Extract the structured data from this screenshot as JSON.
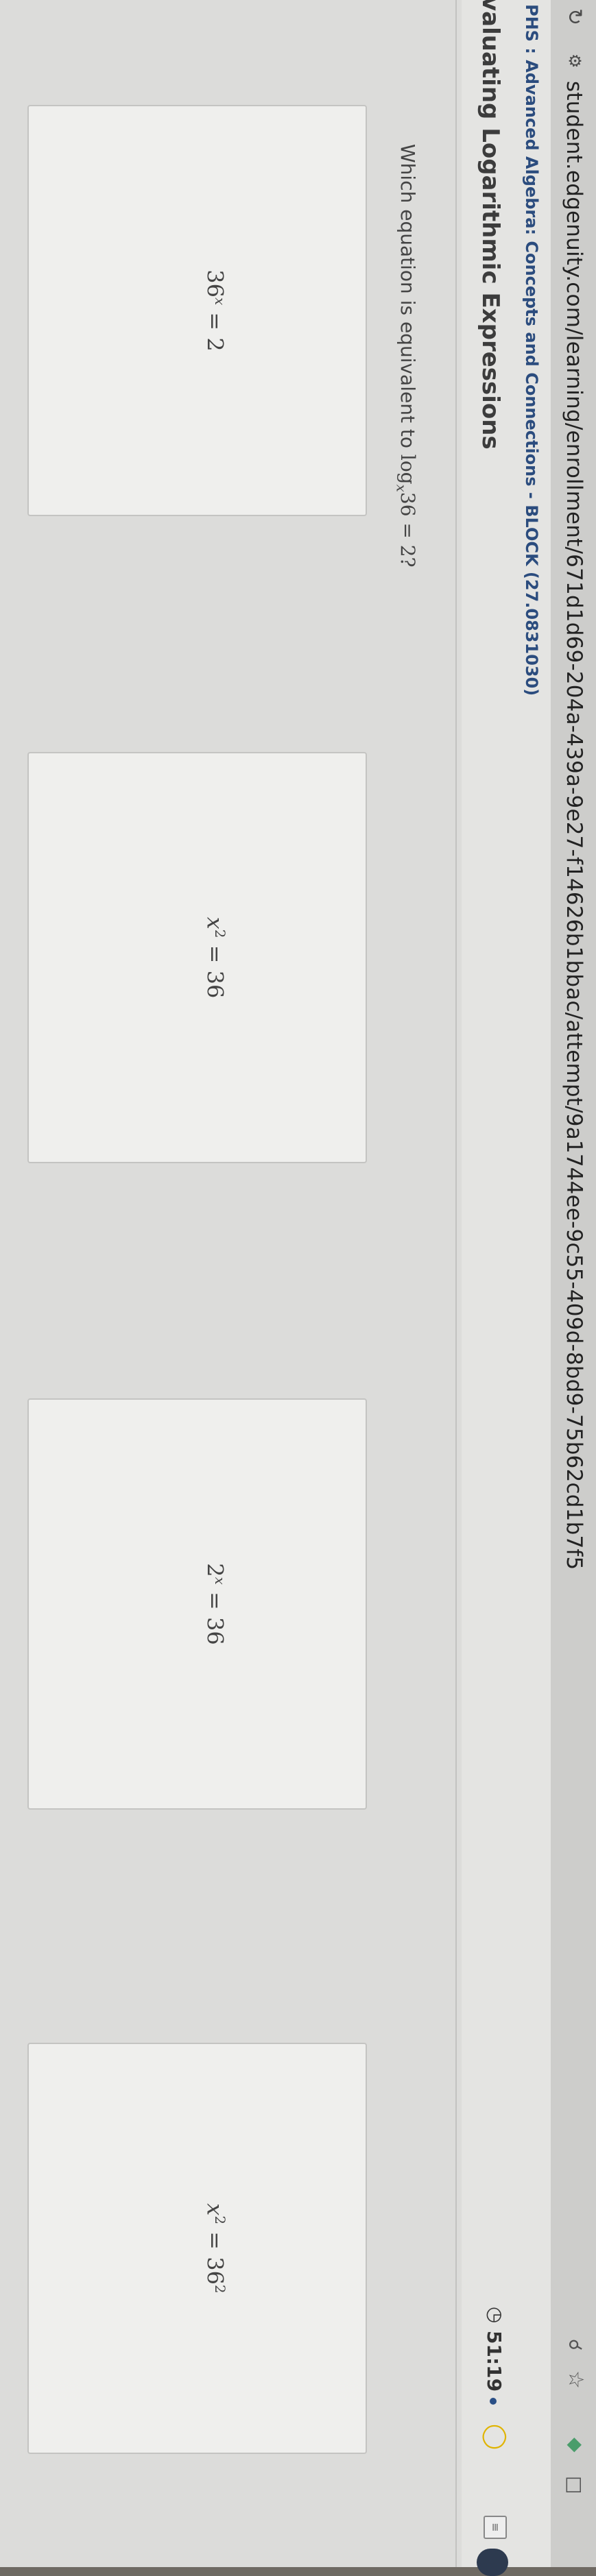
{
  "browser": {
    "url": "student.edgenuity.com/learning/enrollment/671d1d69-204a-439a-9e27-f14626b1bbac/attempt/9a1744ee-9c55-409d-8bd9-75b62cd1b7f5",
    "reload_icon": "reload-icon",
    "site_info_icon": "tune-icon",
    "zoom_icon": "zoom-icon",
    "star_icon": "star-icon",
    "extension_icon": "extension-icon",
    "window_icon": "window-icon"
  },
  "header": {
    "course": "PHS : Advanced Algebra: Concepts and Connections - BLOCK (27.0831030)",
    "lesson": "valuating Logarithmic Expressions",
    "timer": "51:19",
    "lightbulb_icon": "lightbulb-icon"
  },
  "question": {
    "prefix": "Which equation is equivalent to ",
    "log": "log",
    "base": "x",
    "arg": "36",
    "eq": " = 2?"
  },
  "answers": [
    {
      "id": "a",
      "base": "36",
      "exp": "x",
      "rhs": "2"
    },
    {
      "id": "b",
      "base": "x",
      "exp": "2",
      "rhs": "36"
    },
    {
      "id": "c",
      "base": "2",
      "exp": "x",
      "rhs": "36"
    },
    {
      "id": "d",
      "base": "x",
      "exp": "2",
      "rhs": "36",
      "rhs_exp": "2"
    }
  ],
  "colors": {
    "course_title": "#2b4c7e",
    "lightbulb": "#e0b400",
    "extension": "#4a9d6b"
  }
}
